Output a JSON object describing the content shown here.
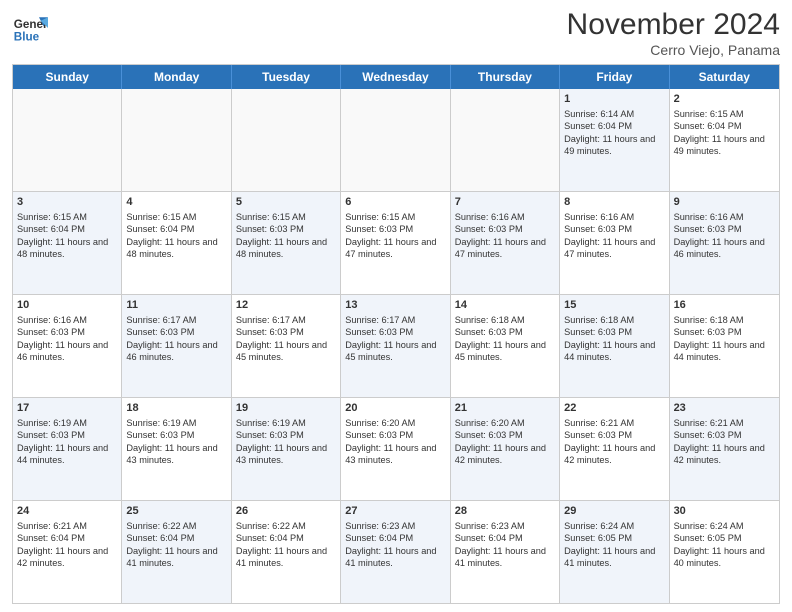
{
  "header": {
    "logo_line1": "General",
    "logo_line2": "Blue",
    "month": "November 2024",
    "location": "Cerro Viejo, Panama"
  },
  "weekdays": [
    "Sunday",
    "Monday",
    "Tuesday",
    "Wednesday",
    "Thursday",
    "Friday",
    "Saturday"
  ],
  "rows": [
    [
      {
        "num": "",
        "info": "",
        "empty": true
      },
      {
        "num": "",
        "info": "",
        "empty": true
      },
      {
        "num": "",
        "info": "",
        "empty": true
      },
      {
        "num": "",
        "info": "",
        "empty": true
      },
      {
        "num": "",
        "info": "",
        "empty": true
      },
      {
        "num": "1",
        "info": "Sunrise: 6:14 AM\nSunset: 6:04 PM\nDaylight: 11 hours and 49 minutes.",
        "alt": true
      },
      {
        "num": "2",
        "info": "Sunrise: 6:15 AM\nSunset: 6:04 PM\nDaylight: 11 hours and 49 minutes.",
        "alt": false
      }
    ],
    [
      {
        "num": "3",
        "info": "Sunrise: 6:15 AM\nSunset: 6:04 PM\nDaylight: 11 hours and 48 minutes.",
        "alt": true
      },
      {
        "num": "4",
        "info": "Sunrise: 6:15 AM\nSunset: 6:04 PM\nDaylight: 11 hours and 48 minutes.",
        "alt": false
      },
      {
        "num": "5",
        "info": "Sunrise: 6:15 AM\nSunset: 6:03 PM\nDaylight: 11 hours and 48 minutes.",
        "alt": true
      },
      {
        "num": "6",
        "info": "Sunrise: 6:15 AM\nSunset: 6:03 PM\nDaylight: 11 hours and 47 minutes.",
        "alt": false
      },
      {
        "num": "7",
        "info": "Sunrise: 6:16 AM\nSunset: 6:03 PM\nDaylight: 11 hours and 47 minutes.",
        "alt": true
      },
      {
        "num": "8",
        "info": "Sunrise: 6:16 AM\nSunset: 6:03 PM\nDaylight: 11 hours and 47 minutes.",
        "alt": false
      },
      {
        "num": "9",
        "info": "Sunrise: 6:16 AM\nSunset: 6:03 PM\nDaylight: 11 hours and 46 minutes.",
        "alt": true
      }
    ],
    [
      {
        "num": "10",
        "info": "Sunrise: 6:16 AM\nSunset: 6:03 PM\nDaylight: 11 hours and 46 minutes.",
        "alt": false
      },
      {
        "num": "11",
        "info": "Sunrise: 6:17 AM\nSunset: 6:03 PM\nDaylight: 11 hours and 46 minutes.",
        "alt": true
      },
      {
        "num": "12",
        "info": "Sunrise: 6:17 AM\nSunset: 6:03 PM\nDaylight: 11 hours and 45 minutes.",
        "alt": false
      },
      {
        "num": "13",
        "info": "Sunrise: 6:17 AM\nSunset: 6:03 PM\nDaylight: 11 hours and 45 minutes.",
        "alt": true
      },
      {
        "num": "14",
        "info": "Sunrise: 6:18 AM\nSunset: 6:03 PM\nDaylight: 11 hours and 45 minutes.",
        "alt": false
      },
      {
        "num": "15",
        "info": "Sunrise: 6:18 AM\nSunset: 6:03 PM\nDaylight: 11 hours and 44 minutes.",
        "alt": true
      },
      {
        "num": "16",
        "info": "Sunrise: 6:18 AM\nSunset: 6:03 PM\nDaylight: 11 hours and 44 minutes.",
        "alt": false
      }
    ],
    [
      {
        "num": "17",
        "info": "Sunrise: 6:19 AM\nSunset: 6:03 PM\nDaylight: 11 hours and 44 minutes.",
        "alt": true
      },
      {
        "num": "18",
        "info": "Sunrise: 6:19 AM\nSunset: 6:03 PM\nDaylight: 11 hours and 43 minutes.",
        "alt": false
      },
      {
        "num": "19",
        "info": "Sunrise: 6:19 AM\nSunset: 6:03 PM\nDaylight: 11 hours and 43 minutes.",
        "alt": true
      },
      {
        "num": "20",
        "info": "Sunrise: 6:20 AM\nSunset: 6:03 PM\nDaylight: 11 hours and 43 minutes.",
        "alt": false
      },
      {
        "num": "21",
        "info": "Sunrise: 6:20 AM\nSunset: 6:03 PM\nDaylight: 11 hours and 42 minutes.",
        "alt": true
      },
      {
        "num": "22",
        "info": "Sunrise: 6:21 AM\nSunset: 6:03 PM\nDaylight: 11 hours and 42 minutes.",
        "alt": false
      },
      {
        "num": "23",
        "info": "Sunrise: 6:21 AM\nSunset: 6:03 PM\nDaylight: 11 hours and 42 minutes.",
        "alt": true
      }
    ],
    [
      {
        "num": "24",
        "info": "Sunrise: 6:21 AM\nSunset: 6:04 PM\nDaylight: 11 hours and 42 minutes.",
        "alt": false
      },
      {
        "num": "25",
        "info": "Sunrise: 6:22 AM\nSunset: 6:04 PM\nDaylight: 11 hours and 41 minutes.",
        "alt": true
      },
      {
        "num": "26",
        "info": "Sunrise: 6:22 AM\nSunset: 6:04 PM\nDaylight: 11 hours and 41 minutes.",
        "alt": false
      },
      {
        "num": "27",
        "info": "Sunrise: 6:23 AM\nSunset: 6:04 PM\nDaylight: 11 hours and 41 minutes.",
        "alt": true
      },
      {
        "num": "28",
        "info": "Sunrise: 6:23 AM\nSunset: 6:04 PM\nDaylight: 11 hours and 41 minutes.",
        "alt": false
      },
      {
        "num": "29",
        "info": "Sunrise: 6:24 AM\nSunset: 6:05 PM\nDaylight: 11 hours and 41 minutes.",
        "alt": true
      },
      {
        "num": "30",
        "info": "Sunrise: 6:24 AM\nSunset: 6:05 PM\nDaylight: 11 hours and 40 minutes.",
        "alt": false
      }
    ]
  ]
}
